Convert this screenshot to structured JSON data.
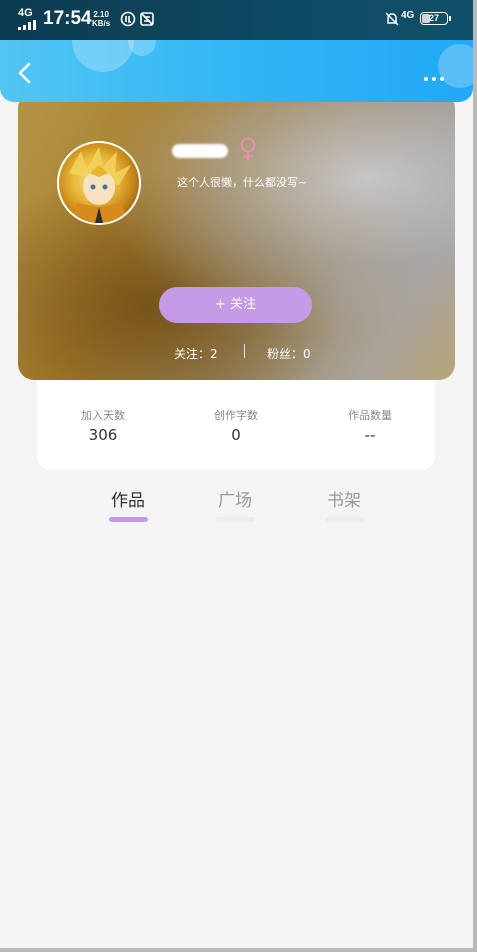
{
  "status_bar": {
    "network_left": "4G",
    "time": "17:54",
    "speed_value": "2.10",
    "speed_unit": "KB/s",
    "network_right": "4G",
    "battery": "27"
  },
  "header": {
    "back_icon": "chevron-left-icon",
    "more_icon": "more-dots-icon"
  },
  "profile": {
    "gender_symbol": "♀",
    "bio": "这个人很懒，什么都没写~",
    "follow_button": "+   关注",
    "following": "关注：2",
    "fans": "粉丝：0"
  },
  "info": [
    {
      "label": "加入天数",
      "value": "306"
    },
    {
      "label": "创作字数",
      "value": "0"
    },
    {
      "label": "作品数量",
      "value": "--"
    }
  ],
  "tabs": [
    {
      "label": "作品",
      "active": true
    },
    {
      "label": "广场",
      "active": false
    },
    {
      "label": "书架",
      "active": false
    }
  ],
  "colors": {
    "header": "#2fb4f5",
    "accent": "#c59ae6",
    "gender": "#e78fb3"
  }
}
